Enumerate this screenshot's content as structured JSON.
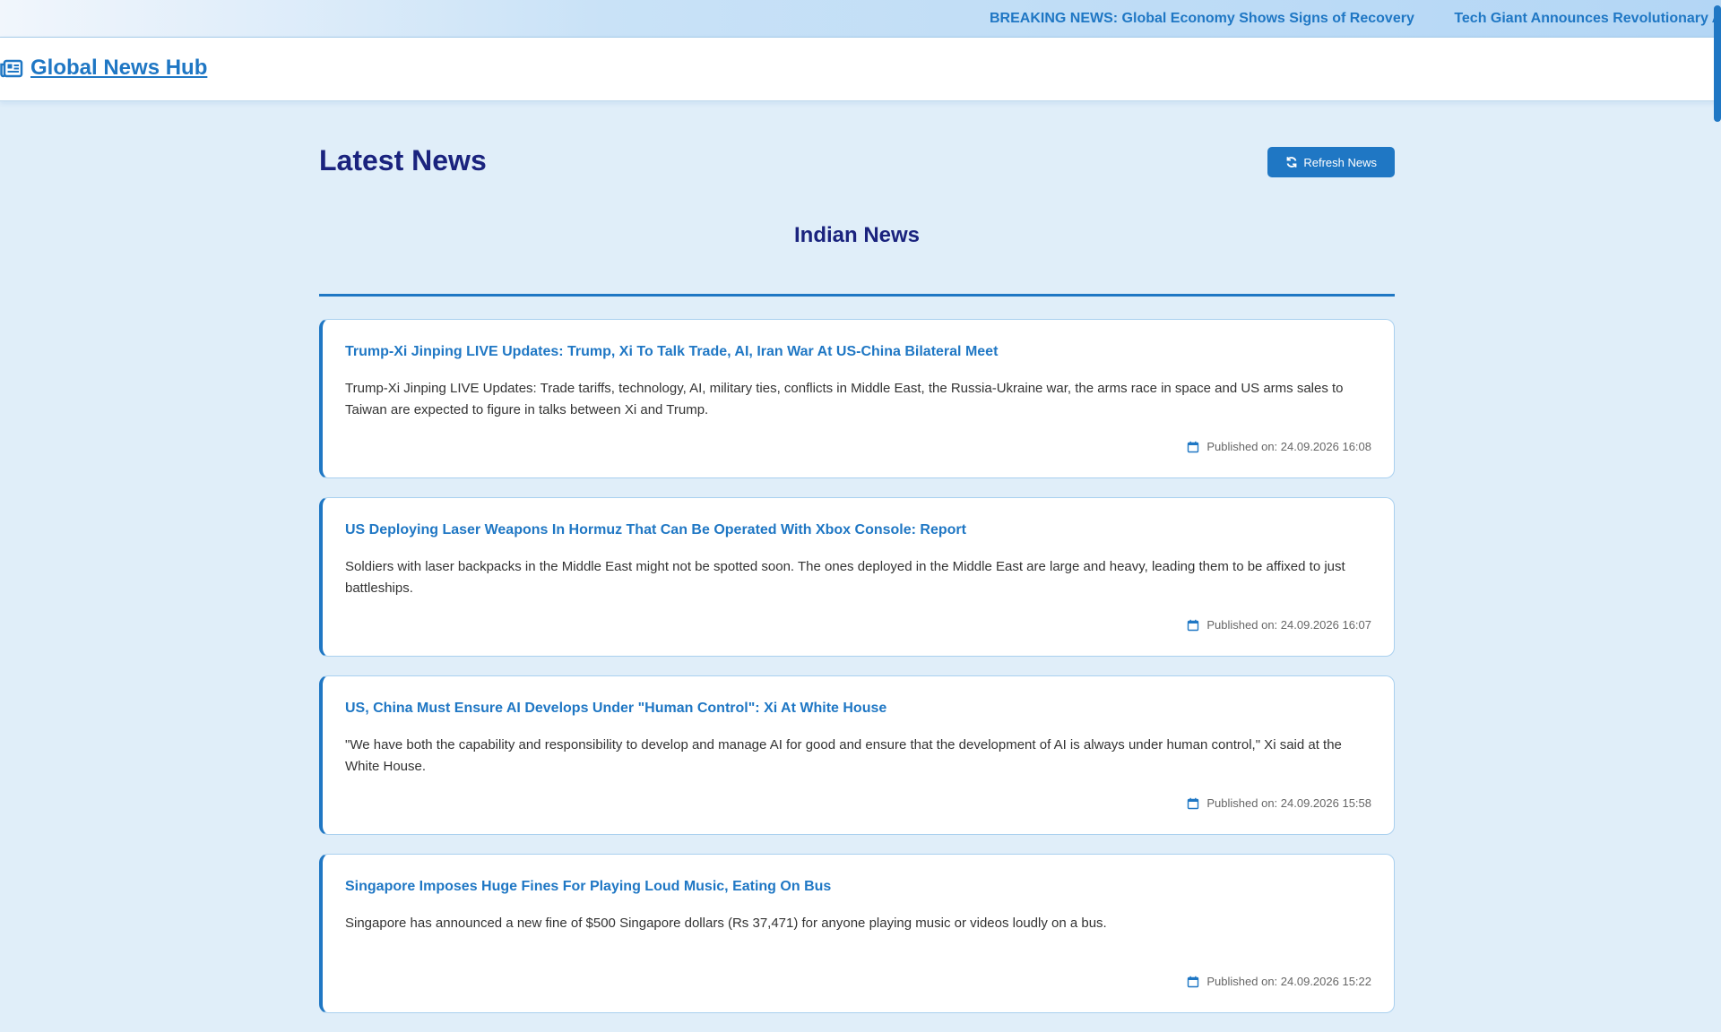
{
  "ticker": {
    "items": [
      "BREAKING NEWS: Global Economy Shows Signs of Recovery",
      "Tech Giant Announces Revolutionary A"
    ]
  },
  "header": {
    "logo_text": "Global News Hub",
    "logo_icon": "newspaper-icon"
  },
  "main": {
    "title": "Latest News",
    "refresh_label": "Refresh News",
    "refresh_icon": "sync-icon",
    "section_title": "Indian News",
    "articles": [
      {
        "title": "Trump-Xi Jinping LIVE Updates: Trump, Xi To Talk Trade, AI, Iran War At US-China Bilateral Meet",
        "summary": "Trump-Xi Jinping LIVE Updates: Trade tariffs, technology, AI, military ties, conflicts in Middle East, the Russia-Ukraine war, the arms race in space and US arms sales to Taiwan are expected to figure in talks between Xi and Trump.",
        "published": "Published on: 24.09.2026 16:08"
      },
      {
        "title": "US Deploying Laser Weapons In Hormuz That Can Be Operated With Xbox Console: Report",
        "summary": "Soldiers with laser backpacks in the Middle East might not be spotted soon. The ones deployed in the Middle East are large and heavy, leading them to be affixed to just battleships.",
        "published": "Published on: 24.09.2026 16:07"
      },
      {
        "title": "US, China Must Ensure AI Develops Under \"Human Control\": Xi At White House",
        "summary": "\"We have both the capability and responsibility to develop and manage AI for good and ensure that the development of AI is always under human control,\" Xi said at the White House.",
        "published": "Published on: 24.09.2026 15:58"
      },
      {
        "title": "Singapore Imposes Huge Fines For Playing Loud Music, Eating On Bus",
        "summary": "Singapore has announced a new fine of $500 Singapore dollars (Rs 37,471) for anyone playing music or videos loudly on a bus.",
        "published": "Published on: 24.09.2026 15:22"
      }
    ]
  },
  "colors": {
    "accent": "#1f77c4",
    "title": "#1a237e",
    "background": "#e0eef9"
  }
}
